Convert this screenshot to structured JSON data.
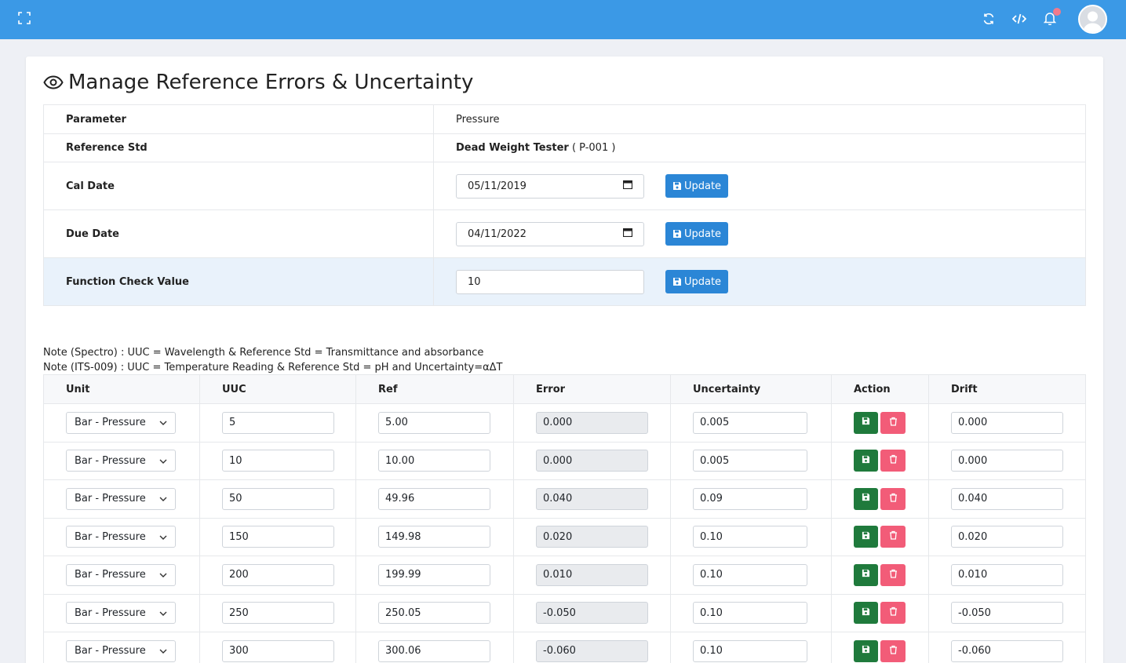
{
  "header": {
    "icons": [
      "fullscreen-icon",
      "refresh-icon",
      "code-icon",
      "bell-icon",
      "avatar"
    ]
  },
  "page": {
    "title": "Manage Reference Errors & Uncertainty"
  },
  "info": {
    "parameter_label": "Parameter",
    "parameter_value": "Pressure",
    "refstd_label": "Reference Std",
    "refstd_name": "Dead Weight Tester",
    "refstd_code": "( P-001 )",
    "caldate_label": "Cal Date",
    "caldate_value": "05/11/2019",
    "duedate_label": "Due Date",
    "duedate_value": "04/11/2022",
    "fcv_label": "Function Check Value",
    "fcv_value": "10",
    "update_label": "Update"
  },
  "notes": {
    "note1": "Note (Spectro) : UUC = Wavelength & Reference Std = Transmittance and absorbance",
    "note2": "Note (ITS-009) : UUC = Temperature Reading & Reference Std = pH and Uncertainty=αΔT"
  },
  "table": {
    "columns": [
      "Unit",
      "UUC",
      "Ref",
      "Error",
      "Uncertainty",
      "Action",
      "Drift"
    ],
    "rows": [
      {
        "unit": "Bar - Pressure",
        "uuc": "5",
        "ref": "5.00",
        "error": "0.000",
        "uncertainty": "0.005",
        "drift": "0.000"
      },
      {
        "unit": "Bar - Pressure",
        "uuc": "10",
        "ref": "10.00",
        "error": "0.000",
        "uncertainty": "0.005",
        "drift": "0.000"
      },
      {
        "unit": "Bar - Pressure",
        "uuc": "50",
        "ref": "49.96",
        "error": "0.040",
        "uncertainty": "0.09",
        "drift": "0.040"
      },
      {
        "unit": "Bar - Pressure",
        "uuc": "150",
        "ref": "149.98",
        "error": "0.020",
        "uncertainty": "0.10",
        "drift": "0.020"
      },
      {
        "unit": "Bar - Pressure",
        "uuc": "200",
        "ref": "199.99",
        "error": "0.010",
        "uncertainty": "0.10",
        "drift": "0.010"
      },
      {
        "unit": "Bar - Pressure",
        "uuc": "250",
        "ref": "250.05",
        "error": "-0.050",
        "uncertainty": "0.10",
        "drift": "-0.050"
      },
      {
        "unit": "Bar - Pressure",
        "uuc": "300",
        "ref": "300.06",
        "error": "-0.060",
        "uncertainty": "0.10",
        "drift": "-0.060"
      }
    ]
  },
  "colors": {
    "header": "#3b99e6",
    "primary": "#2b86d6",
    "success": "#1f7a3c",
    "danger": "#f25c78"
  }
}
